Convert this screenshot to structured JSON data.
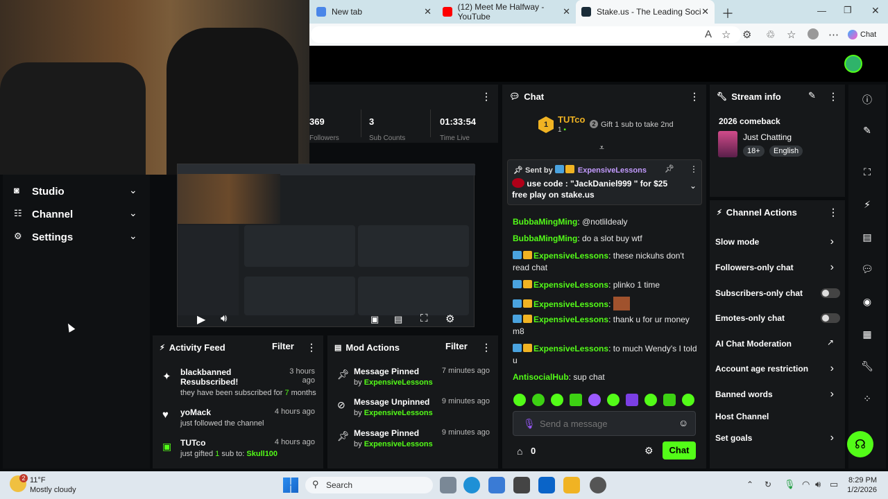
{
  "browser": {
    "tabs": [
      {
        "label": "New tab",
        "color": "#4a86e8"
      },
      {
        "label": "(12) Meet Me Halfway - YouTube",
        "color": "#ff0000"
      },
      {
        "label": "Stake.us - The Leading Social Casi",
        "color": "#1a2c38"
      }
    ],
    "chat_button": "Chat"
  },
  "stats": [
    {
      "value": "369",
      "label": "Followers"
    },
    {
      "value": "3",
      "label": "Sub Counts"
    },
    {
      "value": "01:33:54",
      "label": "Time Live"
    }
  ],
  "sidebar": {
    "items": [
      {
        "label": "Studio"
      },
      {
        "label": "Channel"
      },
      {
        "label": "Settings"
      }
    ]
  },
  "activity": {
    "title": "Activity Feed",
    "filter": "Filter",
    "items": [
      {
        "name": "blackbanned",
        "action": "Resubscribed!",
        "detail_pre": "they have been subscribed for ",
        "detail_hl": "7",
        "detail_post": " months",
        "time": "3 hours ago",
        "icon": "sparkle-icon"
      },
      {
        "name": "yoMack",
        "action": "",
        "detail_pre": "just followed the channel",
        "detail_hl": "",
        "detail_post": "",
        "time": "4 hours ago",
        "icon": "heart-icon"
      },
      {
        "name": "TUTco",
        "action": "",
        "detail_pre": "just gifted ",
        "detail_hl": "1",
        "detail_post": " sub to: ",
        "detail_user": "Skull100",
        "time": "4 hours ago",
        "icon": "gift-icon"
      }
    ]
  },
  "mod_actions": {
    "title": "Mod Actions",
    "filter": "Filter",
    "items": [
      {
        "action": "Message Pinned",
        "by": "by ",
        "user": "ExpensiveLessons",
        "time": "7 minutes ago",
        "icon": "pin-icon"
      },
      {
        "action": "Message Unpinned",
        "by": "by ",
        "user": "ExpensiveLessons",
        "time": "9 minutes ago",
        "icon": "unpin-icon"
      },
      {
        "action": "Message Pinned",
        "by": "by ",
        "user": "ExpensiveLessons",
        "time": "9 minutes ago",
        "icon": "pin-icon"
      }
    ]
  },
  "chat": {
    "title": "Chat",
    "top_gifter": "TUTco",
    "top_gifter_rank": "1",
    "top_gifter_count": "1",
    "gift_rank": "2",
    "gift_prompt": "Gift 1 sub to take 2nd",
    "pinned_sent_by": "Sent by",
    "pinned_user": "ExpensiveLessons",
    "pinned_message": "use code : \"JackDaniel999 \" for $25 free play on stake.us",
    "messages": [
      {
        "user": "BubbaMingMing",
        "text": ": @notlildealy",
        "badges": false,
        "color": "#53fc18"
      },
      {
        "user": "BubbaMingMing",
        "text": ": do a slot buy wtf",
        "badges": false,
        "color": "#53fc18"
      },
      {
        "user": "ExpensiveLessons",
        "text": ": these nickuhs don't read chat",
        "badges": true,
        "color": "#c39bff"
      },
      {
        "user": "ExpensiveLessons",
        "text": ": plinko 1 time",
        "badges": true,
        "color": "#c39bff"
      },
      {
        "user": "ExpensiveLessons",
        "text": ":",
        "badges": true,
        "color": "#c39bff"
      },
      {
        "user": "ExpensiveLessons",
        "text": ": thank u for ur money m8",
        "badges": true,
        "color": "#c39bff"
      },
      {
        "user": "ExpensiveLessons",
        "text": ": to much Wendy's I told u",
        "badges": true,
        "color": "#c39bff"
      },
      {
        "user": "AntisocialHub",
        "text": ": sup chat",
        "badges": false,
        "color": "#53fc18"
      }
    ],
    "placeholder": "Send a message",
    "points": "0",
    "send_button": "Chat"
  },
  "stream_info": {
    "title": "Stream info",
    "stream_title": "2026 comeback",
    "category": "Just Chatting",
    "tags": [
      "18+",
      "English"
    ]
  },
  "channel_actions": {
    "title": "Channel Actions",
    "items": [
      {
        "label": "Slow mode",
        "control": "chevron"
      },
      {
        "label": "Followers-only chat",
        "control": "chevron"
      },
      {
        "label": "Subscribers-only chat",
        "control": "toggle"
      },
      {
        "label": "Emotes-only chat",
        "control": "toggle"
      },
      {
        "label": "AI Chat Moderation",
        "control": "external"
      },
      {
        "label": "Account age restriction",
        "control": "chevron"
      },
      {
        "label": "Banned words",
        "control": "chevron"
      },
      {
        "label": "Host Channel",
        "control": "none"
      },
      {
        "label": "Set goals",
        "control": "chevron"
      }
    ]
  },
  "taskbar": {
    "weather_temp": "11°F",
    "weather_desc": "Mostly cloudy",
    "search": "Search",
    "time": "8:29 PM",
    "date": "1/2/2026",
    "notification_count": "2"
  },
  "colors": {
    "accent": "#53fc18",
    "panel": "#16181a",
    "background": "#0a0c0e",
    "purple": "#c39bff"
  }
}
